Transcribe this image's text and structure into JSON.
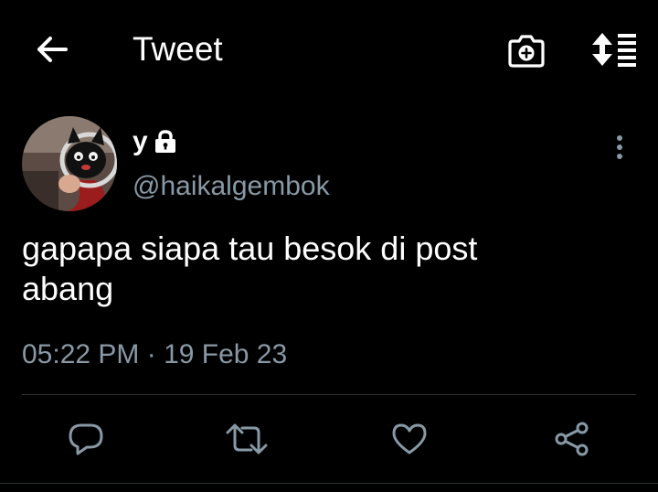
{
  "header": {
    "title": "Tweet",
    "icons": {
      "back": "arrow-left-icon",
      "camera": "camera-add-icon",
      "sort": "sort-list-icon"
    }
  },
  "tweet": {
    "author": {
      "display_name": "y",
      "handle": "@haikalgembok",
      "protected": true
    },
    "text": "gapapa siapa tau besok di post\nabang",
    "timestamp": "05:22 PM · 19 Feb 23"
  },
  "actions": [
    "reply-icon",
    "retweet-icon",
    "like-icon",
    "share-icon"
  ],
  "colors": {
    "background": "#000000",
    "text_primary": "#ffffff",
    "text_secondary": "#8899a6",
    "divider": "#2f3336"
  }
}
